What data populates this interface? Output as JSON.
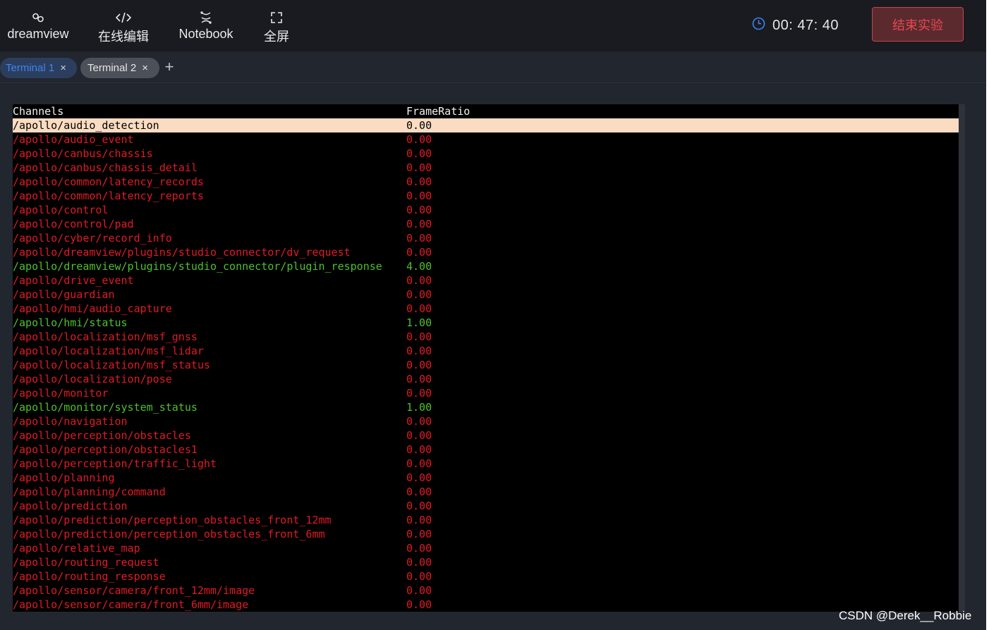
{
  "topbar": {
    "nav": [
      {
        "label": "dreamview",
        "icon": "link-icon"
      },
      {
        "label": "在线编辑",
        "icon": "code-icon"
      },
      {
        "label": "Notebook",
        "icon": "notebook-icon"
      },
      {
        "label": "全屏",
        "icon": "fullscreen-icon"
      }
    ],
    "timer": "00: 47: 40",
    "end_button": "结束实验"
  },
  "tabs": [
    {
      "label": "Terminal 1",
      "active": true
    },
    {
      "label": "Terminal 2",
      "active": false
    }
  ],
  "add_tab": "+",
  "tab_close": "×",
  "colors": {
    "accent": "#3e84f0",
    "danger": "#e8484f",
    "red": "#e01b24",
    "green": "#4fc12a",
    "highlight": "#f9dcc2"
  },
  "terminal": {
    "header": {
      "channel": "Channels",
      "value": "FrameRatio"
    },
    "rows": [
      {
        "channel": "/apollo/audio_detection",
        "value": "0.00",
        "status": "selected"
      },
      {
        "channel": "/apollo/audio_event",
        "value": "0.00",
        "status": "red"
      },
      {
        "channel": "/apollo/canbus/chassis",
        "value": "0.00",
        "status": "red"
      },
      {
        "channel": "/apollo/canbus/chassis_detail",
        "value": "0.00",
        "status": "red"
      },
      {
        "channel": "/apollo/common/latency_records",
        "value": "0.00",
        "status": "red"
      },
      {
        "channel": "/apollo/common/latency_reports",
        "value": "0.00",
        "status": "red"
      },
      {
        "channel": "/apollo/control",
        "value": "0.00",
        "status": "red"
      },
      {
        "channel": "/apollo/control/pad",
        "value": "0.00",
        "status": "red"
      },
      {
        "channel": "/apollo/cyber/record_info",
        "value": "0.00",
        "status": "red"
      },
      {
        "channel": "/apollo/dreamview/plugins/studio_connector/dv_request",
        "value": "0.00",
        "status": "red"
      },
      {
        "channel": "/apollo/dreamview/plugins/studio_connector/plugin_response",
        "value": "4.00",
        "status": "green"
      },
      {
        "channel": "/apollo/drive_event",
        "value": "0.00",
        "status": "red"
      },
      {
        "channel": "/apollo/guardian",
        "value": "0.00",
        "status": "red"
      },
      {
        "channel": "/apollo/hmi/audio_capture",
        "value": "0.00",
        "status": "red"
      },
      {
        "channel": "/apollo/hmi/status",
        "value": "1.00",
        "status": "green"
      },
      {
        "channel": "/apollo/localization/msf_gnss",
        "value": "0.00",
        "status": "red"
      },
      {
        "channel": "/apollo/localization/msf_lidar",
        "value": "0.00",
        "status": "red"
      },
      {
        "channel": "/apollo/localization/msf_status",
        "value": "0.00",
        "status": "red"
      },
      {
        "channel": "/apollo/localization/pose",
        "value": "0.00",
        "status": "red"
      },
      {
        "channel": "/apollo/monitor",
        "value": "0.00",
        "status": "red"
      },
      {
        "channel": "/apollo/monitor/system_status",
        "value": "1.00",
        "status": "green"
      },
      {
        "channel": "/apollo/navigation",
        "value": "0.00",
        "status": "red"
      },
      {
        "channel": "/apollo/perception/obstacles",
        "value": "0.00",
        "status": "red"
      },
      {
        "channel": "/apollo/perception/obstacles1",
        "value": "0.00",
        "status": "red"
      },
      {
        "channel": "/apollo/perception/traffic_light",
        "value": "0.00",
        "status": "red"
      },
      {
        "channel": "/apollo/planning",
        "value": "0.00",
        "status": "red"
      },
      {
        "channel": "/apollo/planning/command",
        "value": "0.00",
        "status": "red"
      },
      {
        "channel": "/apollo/prediction",
        "value": "0.00",
        "status": "red"
      },
      {
        "channel": "/apollo/prediction/perception_obstacles_front_12mm",
        "value": "0.00",
        "status": "red"
      },
      {
        "channel": "/apollo/prediction/perception_obstacles_front_6mm",
        "value": "0.00",
        "status": "red"
      },
      {
        "channel": "/apollo/relative_map",
        "value": "0.00",
        "status": "red"
      },
      {
        "channel": "/apollo/routing_request",
        "value": "0.00",
        "status": "red"
      },
      {
        "channel": "/apollo/routing_response",
        "value": "0.00",
        "status": "red"
      },
      {
        "channel": "/apollo/sensor/camera/front_12mm/image",
        "value": "0.00",
        "status": "red"
      },
      {
        "channel": "/apollo/sensor/camera/front_6mm/image",
        "value": "0.00",
        "status": "red"
      }
    ]
  },
  "watermark": "CSDN @Derek__Robbie"
}
